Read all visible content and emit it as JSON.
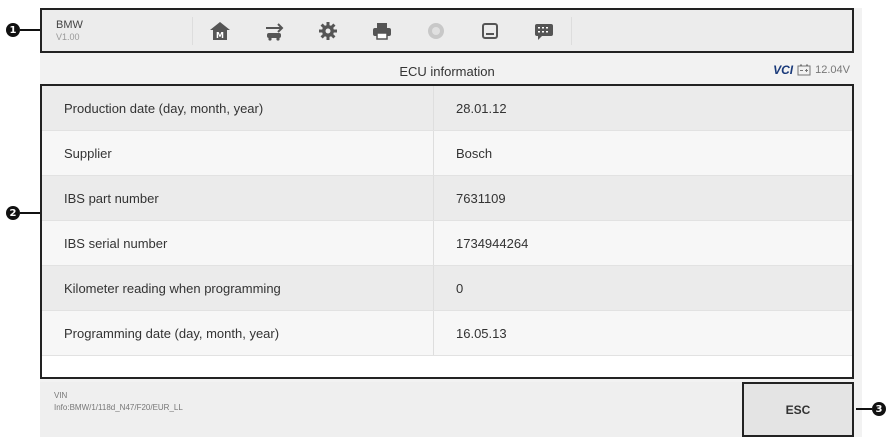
{
  "callouts": {
    "one": "1",
    "two": "2",
    "three": "3"
  },
  "brand": {
    "name": "BMW",
    "version": "V1.00"
  },
  "toolbar": {
    "buttons": [
      {
        "icon": "home-icon"
      },
      {
        "icon": "vehicle-swap-icon"
      },
      {
        "icon": "gear-icon"
      },
      {
        "icon": "print-icon"
      },
      {
        "icon": "help-icon"
      },
      {
        "icon": "save-icon"
      },
      {
        "icon": "data-log-icon"
      }
    ]
  },
  "title": "ECU information",
  "status": {
    "vci": "VCI",
    "voltage": "12.04V"
  },
  "rows": [
    {
      "label": "Production date (day, month, year)",
      "value": "28.01.12"
    },
    {
      "label": "Supplier",
      "value": "Bosch"
    },
    {
      "label": "IBS part number",
      "value": "7631109"
    },
    {
      "label": "IBS serial number",
      "value": "1734944264"
    },
    {
      "label": "Kilometer reading when programming",
      "value": "0"
    },
    {
      "label": "Programming date (day, month, year)",
      "value": "16.05.13"
    }
  ],
  "bottom": {
    "vin_label": "VIN",
    "info": "Info:BMW/1/118d_N47/F20/EUR_LL",
    "esc_label": "ESC"
  },
  "colors": {
    "accent": "#1a3a7a",
    "frame": "#222222"
  }
}
